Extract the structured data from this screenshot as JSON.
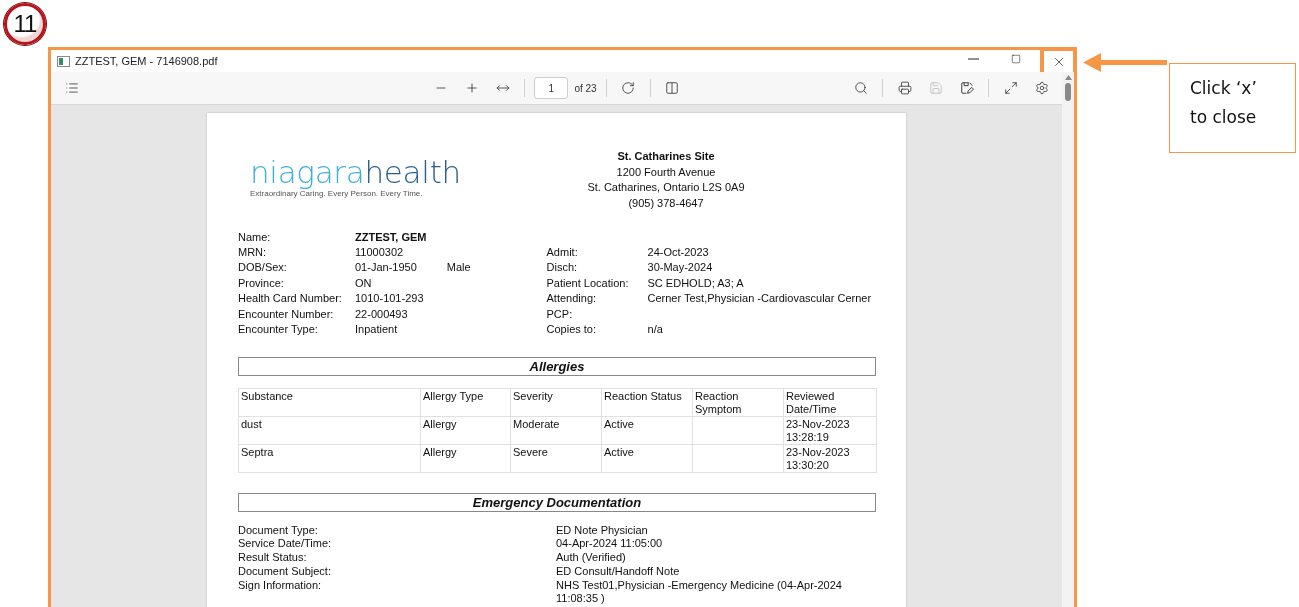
{
  "annotation": {
    "step": "11",
    "callout": "Click ‘x’ to close"
  },
  "window": {
    "title": "ZZTEST, GEM - 7146908.pdf",
    "controls": [
      {
        "kind": "minimize",
        "highlighted": false
      },
      {
        "kind": "maximize",
        "highlighted": false
      },
      {
        "kind": "close",
        "highlighted": true
      }
    ]
  },
  "toolbar": {
    "left": [
      {
        "kind": "contents",
        "disabled": false
      }
    ],
    "center": [
      {
        "kind": "zoom-out",
        "disabled": false
      },
      {
        "kind": "zoom-in",
        "disabled": false
      },
      {
        "kind": "fit-width",
        "disabled": false
      },
      {
        "kind": "separator"
      },
      {
        "kind": "page",
        "value": "1",
        "total": "of 23"
      },
      {
        "kind": "separator"
      },
      {
        "kind": "rotate",
        "disabled": false
      },
      {
        "kind": "separator"
      },
      {
        "kind": "page-view",
        "disabled": false
      }
    ],
    "right": [
      {
        "kind": "search",
        "disabled": false
      },
      {
        "kind": "separator"
      },
      {
        "kind": "print",
        "disabled": false
      },
      {
        "kind": "save",
        "disabled": true
      },
      {
        "kind": "save-as",
        "disabled": false
      },
      {
        "kind": "separator"
      },
      {
        "kind": "fullscreen",
        "disabled": false
      },
      {
        "kind": "settings",
        "disabled": false
      }
    ]
  },
  "document": {
    "logo": {
      "light": "niagara",
      "dark": "health",
      "tagline": "Extraordinary Caring. Every Person. Every Time."
    },
    "site": {
      "name": "St. Catharines Site",
      "lines": [
        "1200 Fourth Avenue",
        "St. Catharines, Ontario L2S 0A9",
        "(905) 378-4647"
      ]
    },
    "patient_left": [
      {
        "label": "Name:",
        "value": "ZZTEST, GEM",
        "bold": true
      },
      {
        "label": "MRN:",
        "value": "11000302",
        "bold": false
      },
      {
        "label": "DOB/Sex:",
        "value": "01-Jan-1950",
        "extra": "Male",
        "bold": false
      },
      {
        "label": "Province:",
        "value": "ON",
        "bold": false
      },
      {
        "label": "Health Card Number:",
        "value": "1010-101-293",
        "bold": false
      },
      {
        "label": "Encounter Number:",
        "value": "22-000493",
        "bold": false
      },
      {
        "label": "Encounter Type:",
        "value": "Inpatient",
        "bold": false
      }
    ],
    "patient_right": [
      {
        "label": "Admit:",
        "value": "24-Oct-2023"
      },
      {
        "label": "Disch:",
        "value": "30-May-2024"
      },
      {
        "label": "Patient Location:",
        "value": "SC EDHOLD; A3; A"
      },
      {
        "label": "Attending:",
        "value": "Cerner Test,Physician -Cardiovascular Cerner"
      },
      {
        "label": "PCP:"
      },
      {
        "label": "Copies to:",
        "value": "n/a"
      }
    ],
    "allergies": {
      "title": "Allergies",
      "columns": [
        "Substance",
        "Allergy Type",
        "Severity",
        "Reaction Status",
        "Reaction Symptom",
        "Reviewed Date/Time"
      ],
      "rows": [
        [
          "dust",
          "Allergy",
          "Moderate",
          "Active",
          "",
          "23-Nov-2023 13:28:19"
        ],
        [
          "Septra",
          "Allergy",
          "Severe",
          "Active",
          "",
          "23-Nov-2023 13:30:20"
        ]
      ]
    },
    "emergency": {
      "title": "Emergency Documentation",
      "fields": [
        {
          "label": "Document Type:",
          "value": "ED Note Physician"
        },
        {
          "label": "Service Date/Time:",
          "value": "04-Apr-2024 11:05:00"
        },
        {
          "label": "Result Status:",
          "value": "Auth (Verified)"
        },
        {
          "label": "Document Subject:",
          "value": "ED Consult/Handoff Note"
        },
        {
          "label": "Sign Information:",
          "value": "NHS Test01,Physician -Emergency Medicine (04-Apr-2024 11:08:35 )"
        }
      ]
    }
  }
}
